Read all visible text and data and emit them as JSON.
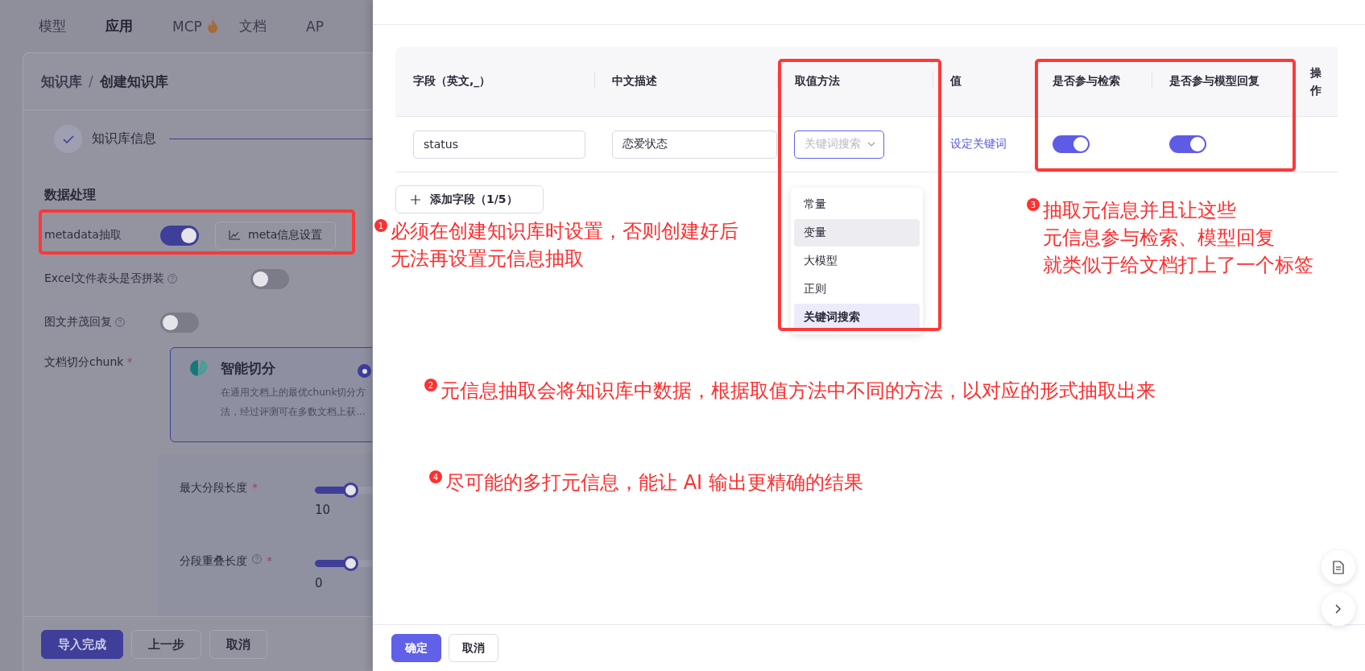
{
  "nav_tabs": [
    {
      "label": "模型",
      "selected": false,
      "hot": false
    },
    {
      "label": "应用",
      "selected": true,
      "hot": false
    },
    {
      "label": "MCP",
      "selected": false,
      "hot": true
    },
    {
      "label": "文档",
      "selected": false,
      "hot": false
    },
    {
      "label": "AP",
      "selected": false,
      "hot": false
    }
  ],
  "breadcrumb": [
    "知识库",
    "创建知识库"
  ],
  "breadcrumb_separator": "/",
  "steps": [
    {
      "label": "知识库信息",
      "done": true
    }
  ],
  "section_title": "数据处理",
  "settings": [
    {
      "label": "metadata抽取",
      "help": false,
      "on": true,
      "button": "meta信息设置"
    },
    {
      "label": "Excel文件表头是否拼装",
      "help": true,
      "on": false
    },
    {
      "label": "图文并茂回复",
      "help": true,
      "on": false
    }
  ],
  "chunk": {
    "label": "文档切分chunk",
    "required_mark": "*",
    "option": {
      "title": "智能切分",
      "description": "在通用文档上的最优chunk切分方法，经过评测可在多数文档上获...",
      "selected": true
    },
    "sliders": [
      {
        "label": "最大分段长度",
        "help": false,
        "required_mark": "*",
        "level": 0.2,
        "reading": "10"
      },
      {
        "label": "分段重叠长度",
        "help": true,
        "required_mark": "*",
        "level": 0.2,
        "reading": "0"
      }
    ]
  },
  "page_buttons": [
    {
      "label": "导入完成",
      "kind": "primary"
    },
    {
      "label": "上一步",
      "kind": "default"
    },
    {
      "label": "取消",
      "kind": "default"
    }
  ],
  "drawer": {
    "columns": [
      "字段（英文,_）",
      "中文描述",
      "取值方法",
      "值",
      "是否参与检索",
      "是否参与模型回复",
      "操作"
    ],
    "rows": [
      {
        "field": "status",
        "description": "恋爱状态",
        "method": "关键词搜索",
        "value": "设定关键词",
        "in_search": true,
        "in_reply": true
      }
    ],
    "add_button": "添加字段（1/5）",
    "method_options": [
      {
        "label": "常量",
        "selected": false,
        "hovered": false
      },
      {
        "label": "变量",
        "selected": false,
        "hovered": true
      },
      {
        "label": "大模型",
        "selected": false,
        "hovered": false
      },
      {
        "label": "正则",
        "selected": false,
        "hovered": false
      },
      {
        "label": "关键词搜索",
        "selected": true,
        "hovered": false
      }
    ],
    "buttons": [
      {
        "label": "确定",
        "kind": "primary"
      },
      {
        "label": "取消",
        "kind": "default"
      }
    ]
  },
  "annotations": [
    {
      "number": "1",
      "lines": [
        "必须在创建知识库时设置，否则创建好后",
        "无法再设置元信息抽取"
      ]
    },
    {
      "number": "2",
      "lines": [
        "元信息抽取会将知识库中数据，根据取值方法中不同的方法，以对应的形式抽取出来"
      ]
    },
    {
      "number": "3",
      "lines": [
        "抽取元信息并且让这些",
        "元信息参与检索、模型回复",
        "就类似于给文档打上了一个标签"
      ]
    },
    {
      "number": "4",
      "lines": [
        "尽可能的多打元信息，能让 AI 输出更精确的结果"
      ]
    }
  ]
}
